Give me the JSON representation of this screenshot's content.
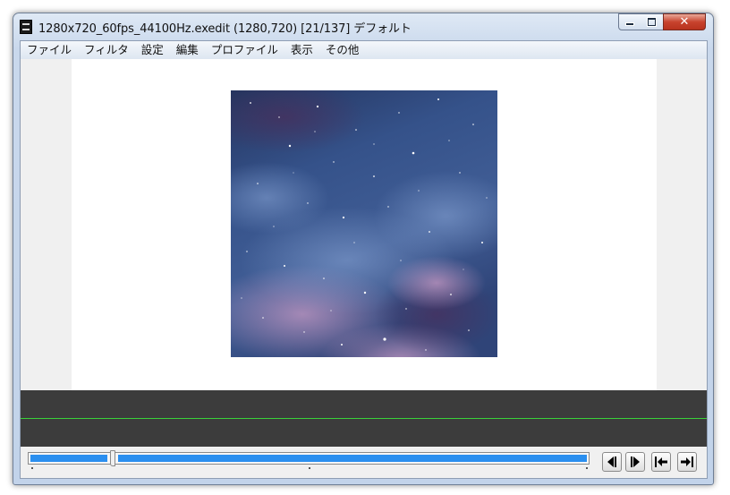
{
  "window": {
    "title": "1280x720_60fps_44100Hz.exedit (1280,720)  [21/137]  デフォルト",
    "minimize_icon": "minimize-icon",
    "maximize_icon": "maximize-icon",
    "close_icon": "close-icon",
    "close_label": "✕"
  },
  "menu": {
    "items": [
      "ファイル",
      "フィルタ",
      "設定",
      "編集",
      "プロファイル",
      "表示",
      "その他"
    ]
  },
  "playback": {
    "current_frame": 21,
    "total_frames": 137,
    "buttons": [
      {
        "icon": "prev-frame-icon"
      },
      {
        "icon": "next-frame-icon"
      },
      {
        "icon": "first-frame-icon"
      },
      {
        "icon": "last-frame-icon"
      }
    ]
  },
  "colors": {
    "seek_fill": "#2b8fef",
    "timeline_bg": "#3c3c3c",
    "waveform_line": "#3ad13a",
    "close_button": "#c8432e"
  }
}
